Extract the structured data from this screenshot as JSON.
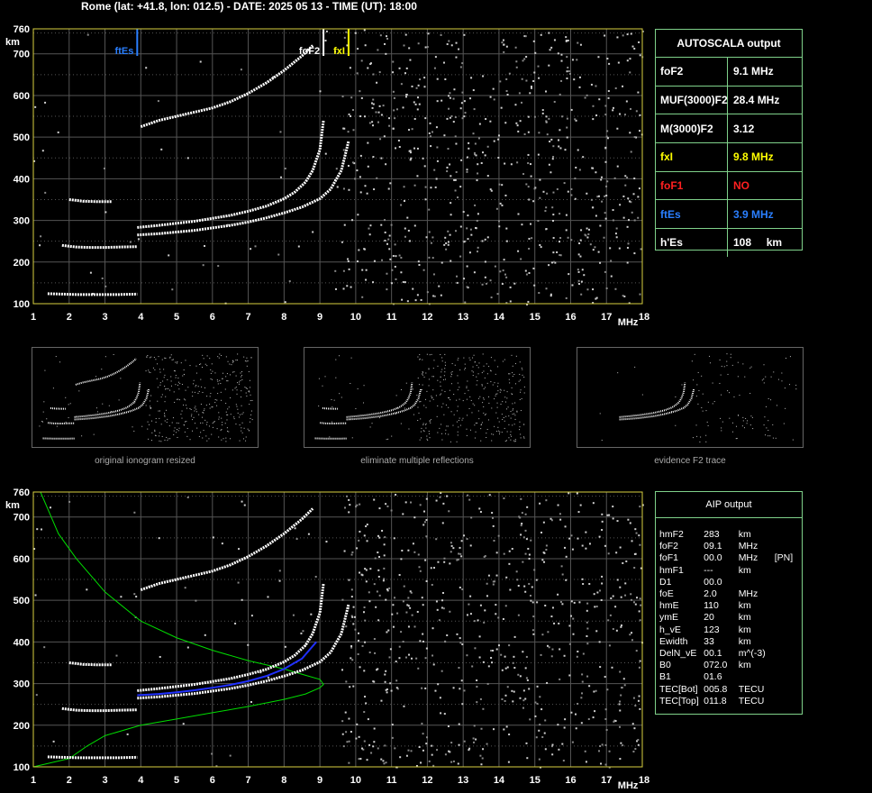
{
  "header": {
    "title": "Rome (lat: +41.8, lon: 012.5) - DATE: 2025 05 13 - TIME (UT): 18:00"
  },
  "colors": {
    "grid": "#555555",
    "frame": "#d8d040",
    "ftEs": "#2a7fff",
    "fxI": "#ffff00",
    "foF1": "#ff2020",
    "profile": "#00dd00",
    "panel_border": "#7fd18a",
    "inversion": "#2030ff"
  },
  "chart_data": [
    {
      "type": "scatter",
      "ylabel": "km",
      "xlabel": "MHz",
      "xlim": [
        1,
        18
      ],
      "ylim": [
        100,
        760
      ],
      "x_ticks": [
        1,
        2,
        3,
        4,
        5,
        6,
        7,
        8,
        9,
        10,
        11,
        12,
        13,
        14,
        15,
        16,
        17,
        18
      ],
      "y_ticks": [
        100,
        200,
        300,
        400,
        500,
        600,
        700,
        760
      ],
      "markers": [
        {
          "label": "ftEs",
          "x": 3.9,
          "color": "#2a7fff"
        },
        {
          "label": "foF2",
          "x": 9.1,
          "color": "#ffffff"
        },
        {
          "label": "fxI",
          "x": 9.8,
          "color": "#ffff00"
        }
      ],
      "traces": [
        {
          "name": "Es",
          "x": [
            1.4,
            1.8,
            2.2,
            2.6,
            3.0,
            3.4,
            3.9
          ],
          "y": [
            124,
            123,
            122,
            122,
            122,
            122,
            123
          ]
        },
        {
          "name": "E",
          "x": [
            1.8,
            2.2,
            2.6,
            3.0,
            3.4,
            3.9
          ],
          "y": [
            240,
            236,
            235,
            235,
            236,
            237
          ]
        },
        {
          "name": "E2",
          "x": [
            2.0,
            2.4,
            2.8,
            3.2
          ],
          "y": [
            350,
            346,
            345,
            345
          ]
        },
        {
          "name": "F2o",
          "x": [
            3.9,
            4.5,
            5.0,
            5.5,
            6.0,
            6.5,
            7.0,
            7.5,
            8.0,
            8.3,
            8.6,
            8.8,
            9.0,
            9.1
          ],
          "y": [
            283,
            288,
            293,
            298,
            305,
            312,
            322,
            334,
            352,
            368,
            392,
            420,
            470,
            540
          ]
        },
        {
          "name": "F2x",
          "x": [
            3.9,
            4.5,
            5.0,
            5.5,
            6.0,
            6.5,
            7.0,
            7.5,
            8.0,
            8.5,
            9.0,
            9.3,
            9.6,
            9.8
          ],
          "y": [
            265,
            268,
            272,
            276,
            282,
            288,
            296,
            306,
            318,
            332,
            352,
            375,
            420,
            490
          ]
        },
        {
          "name": "F2mult",
          "x": [
            4.0,
            4.5,
            5.0,
            5.5,
            6.0,
            6.5,
            7.0,
            7.5,
            8.0,
            8.5,
            8.8
          ],
          "y": [
            525,
            540,
            550,
            560,
            570,
            585,
            605,
            630,
            660,
            695,
            720
          ]
        }
      ]
    },
    {
      "type": "line",
      "ylabel": "km",
      "xlabel": "MHz",
      "xlim": [
        1,
        18
      ],
      "ylim": [
        100,
        760
      ],
      "x_ticks": [
        1,
        2,
        3,
        4,
        5,
        6,
        7,
        8,
        9,
        10,
        11,
        12,
        13,
        14,
        15,
        16,
        17,
        18
      ],
      "y_ticks": [
        100,
        200,
        300,
        400,
        500,
        600,
        700,
        760
      ],
      "profile": {
        "x": [
          1.0,
          1.5,
          2.0,
          2.5,
          3.0,
          4.0,
          5.0,
          6.0,
          7.0,
          8.0,
          8.6,
          9.0,
          9.1,
          9.0,
          8.6,
          8.0,
          7.0,
          6.0,
          5.0,
          4.0,
          3.0,
          2.2,
          1.7,
          1.5,
          1.3,
          1.2
        ],
        "y": [
          100,
          110,
          120,
          150,
          175,
          200,
          215,
          230,
          245,
          262,
          275,
          290,
          298,
          310,
          320,
          335,
          355,
          380,
          410,
          450,
          520,
          600,
          660,
          700,
          740,
          760
        ]
      },
      "traces": [
        {
          "name": "Es",
          "x": [
            1.4,
            1.8,
            2.2,
            2.6,
            3.0,
            3.4,
            3.9
          ],
          "y": [
            124,
            123,
            122,
            122,
            122,
            122,
            123
          ]
        },
        {
          "name": "E",
          "x": [
            1.8,
            2.2,
            2.6,
            3.0,
            3.4,
            3.9
          ],
          "y": [
            240,
            236,
            235,
            235,
            236,
            237
          ]
        },
        {
          "name": "E2",
          "x": [
            2.0,
            2.4,
            2.8,
            3.2
          ],
          "y": [
            350,
            346,
            345,
            345
          ]
        },
        {
          "name": "F2o",
          "x": [
            3.9,
            4.5,
            5.0,
            5.5,
            6.0,
            6.5,
            7.0,
            7.5,
            8.0,
            8.3,
            8.6,
            8.8,
            9.0,
            9.1
          ],
          "y": [
            283,
            288,
            293,
            298,
            305,
            312,
            322,
            334,
            352,
            368,
            392,
            420,
            470,
            540
          ]
        },
        {
          "name": "F2x",
          "x": [
            3.9,
            4.5,
            5.0,
            5.5,
            6.0,
            6.5,
            7.0,
            7.5,
            8.0,
            8.5,
            9.0,
            9.3,
            9.6,
            9.8
          ],
          "y": [
            265,
            268,
            272,
            276,
            282,
            288,
            296,
            306,
            318,
            332,
            352,
            375,
            420,
            490
          ]
        },
        {
          "name": "F2mult",
          "x": [
            4.0,
            4.5,
            5.0,
            5.5,
            6.0,
            6.5,
            7.0,
            7.5,
            8.0,
            8.5,
            8.8
          ],
          "y": [
            525,
            540,
            550,
            560,
            570,
            585,
            605,
            630,
            660,
            695,
            720
          ]
        }
      ],
      "fit": {
        "x": [
          3.9,
          4.5,
          5.0,
          5.5,
          6.0,
          6.5,
          7.0,
          7.5,
          8.0,
          8.5,
          8.9
        ],
        "y": [
          272,
          275,
          279,
          284,
          290,
          297,
          306,
          318,
          335,
          360,
          400
        ]
      }
    }
  ],
  "autoscala": {
    "title": "AUTOSCALA output",
    "rows": [
      {
        "key": "foF2",
        "value": "9.1 MHz",
        "color": "#ffffff"
      },
      {
        "key": "MUF(3000)F2",
        "value": "28.4 MHz",
        "color": "#ffffff"
      },
      {
        "key": "M(3000)F2",
        "value": "3.12",
        "color": "#ffffff"
      },
      {
        "key": "fxI",
        "value": "9.8 MHz",
        "color": "#ffff00"
      },
      {
        "key": "foF1",
        "value": "NO",
        "color": "#ff2020"
      },
      {
        "key": "ftEs",
        "value": "3.9 MHz",
        "color": "#2a7fff"
      },
      {
        "key": "h'Es",
        "value": "108     km",
        "color": "#ffffff"
      }
    ]
  },
  "captions": [
    "original ionogram resized",
    "eliminate multiple reflections",
    "evidence F2 trace"
  ],
  "aip": {
    "title": "AIP output",
    "rows": [
      [
        "hmF2",
        "283",
        "km",
        ""
      ],
      [
        "foF2",
        "09.1",
        "MHz",
        ""
      ],
      [
        "foF1",
        "00.0",
        "MHz",
        "[PN]"
      ],
      [
        "hmF1",
        "---",
        "km",
        ""
      ],
      [
        "D1",
        "00.0",
        "",
        ""
      ],
      [
        "foE",
        "2.0",
        "MHz",
        ""
      ],
      [
        "hmE",
        "110",
        "km",
        ""
      ],
      [
        "ymE",
        "20",
        "km",
        ""
      ],
      [
        "h_vE",
        "123",
        "km",
        ""
      ],
      [
        "Ewidth",
        "33",
        "km",
        ""
      ],
      [
        "DelN_vE",
        "00.1",
        "m^(-3)",
        ""
      ],
      [
        "B0",
        "072.0",
        "km",
        ""
      ],
      [
        "B1",
        "01.6",
        "",
        ""
      ],
      [
        "TEC[Bot]",
        "005.8",
        "TECU",
        ""
      ],
      [
        "TEC[Top]",
        "011.8",
        "TECU",
        ""
      ]
    ]
  }
}
